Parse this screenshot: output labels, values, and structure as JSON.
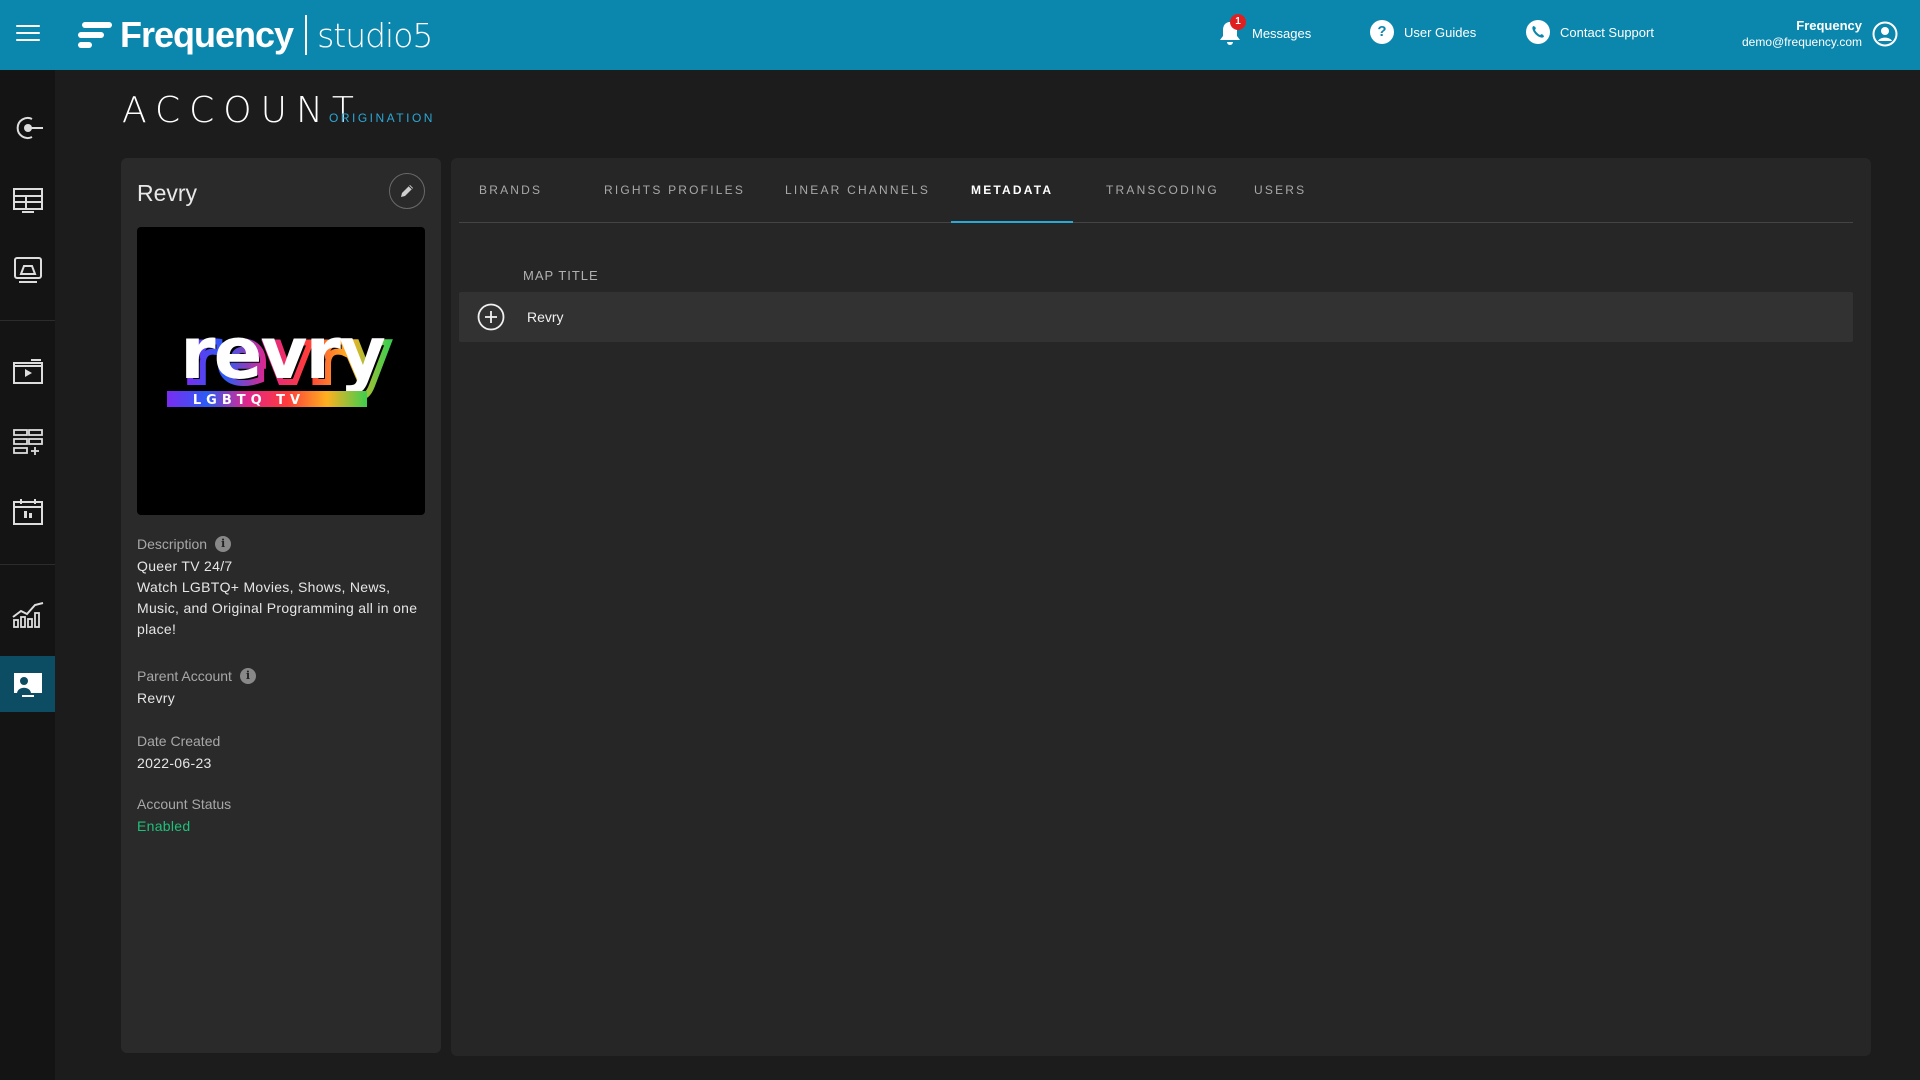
{
  "app": {
    "brand": "Frequency",
    "product": "studio5"
  },
  "header": {
    "messages_label": "Messages",
    "messages_count": "1",
    "guides_label": "User Guides",
    "support_label": "Contact Support",
    "user_name": "Frequency",
    "user_email": "demo@frequency.com",
    "accent_color": "#0b87ad"
  },
  "sidebar": {
    "items": [
      {
        "icon": "origination-icon"
      },
      {
        "icon": "layout-grid-icon"
      },
      {
        "icon": "monitor-icon"
      },
      {
        "icon": "video-folder-icon"
      },
      {
        "icon": "add-list-icon"
      },
      {
        "icon": "calendar-icon"
      },
      {
        "icon": "analytics-icon"
      },
      {
        "icon": "account-icon",
        "active": true
      }
    ]
  },
  "page": {
    "title": "ACCOUNT",
    "subtitle": "ORIGINATION"
  },
  "account": {
    "name": "Revry",
    "logo_text": "revry",
    "logo_tagline": "LGBTQ TV",
    "description_label": "Description",
    "description_line1": "Queer TV 24/7",
    "description_line2": "Watch LGBTQ+ Movies, Shows, News, Music, and Original Programming all in one place!",
    "parent_label": "Parent Account",
    "parent_value": "Revry",
    "created_label": "Date Created",
    "created_value": "2022-06-23",
    "status_label": "Account Status",
    "status_value": "Enabled",
    "status_color": "#1fc07a"
  },
  "tabs": [
    {
      "label": "BRANDS"
    },
    {
      "label": "RIGHTS PROFILES"
    },
    {
      "label": "LINEAR CHANNELS"
    },
    {
      "label": "METADATA",
      "active": true
    },
    {
      "label": "TRANSCODING"
    },
    {
      "label": "USERS"
    }
  ],
  "metadata": {
    "column_header": "MAP TITLE",
    "rows": [
      {
        "title": "Revry"
      }
    ]
  }
}
